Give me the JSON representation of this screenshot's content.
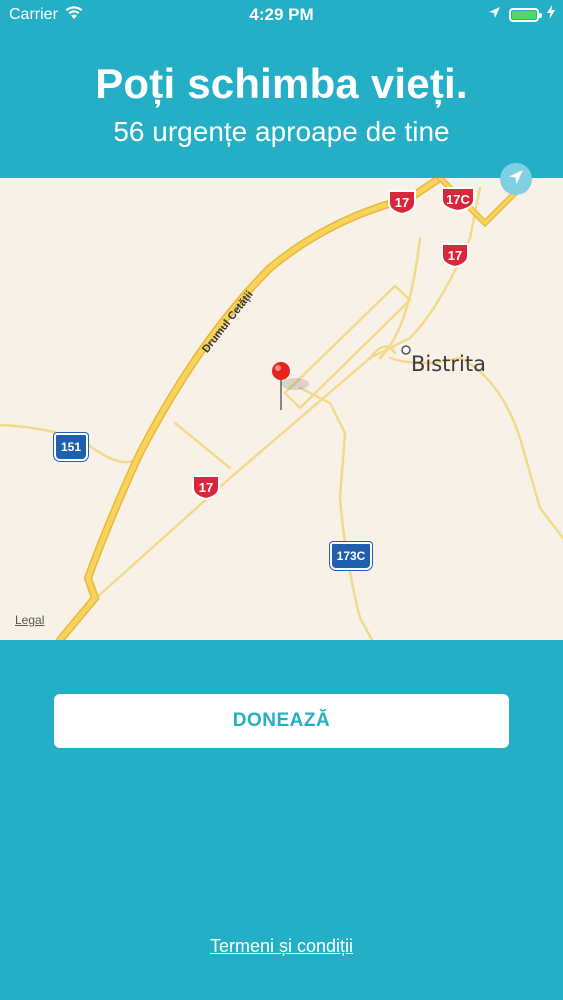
{
  "status_bar": {
    "carrier": "Carrier",
    "time": "4:29 PM",
    "battery_level": 1.0
  },
  "header": {
    "title": "Poți schimba vieți.",
    "subtitle": "56 urgențe aproape de tine"
  },
  "map": {
    "city_label": "Bistrita",
    "road_label": "Drumul Cetății",
    "legal_label": "Legal",
    "shields": {
      "red_1": "17",
      "red_2": "17C",
      "red_3": "17",
      "red_4": "17",
      "blue_1": "151",
      "blue_2": "173C"
    },
    "pin_color": "#E8221C"
  },
  "actions": {
    "donate_label": "DONEAZĂ",
    "terms_label": "Termeni și condiții"
  },
  "colors": {
    "brand": "#24AFC7",
    "map_background": "#F8F1E7",
    "major_road": "#F6C94A",
    "minor_road": "#F3D98C"
  }
}
